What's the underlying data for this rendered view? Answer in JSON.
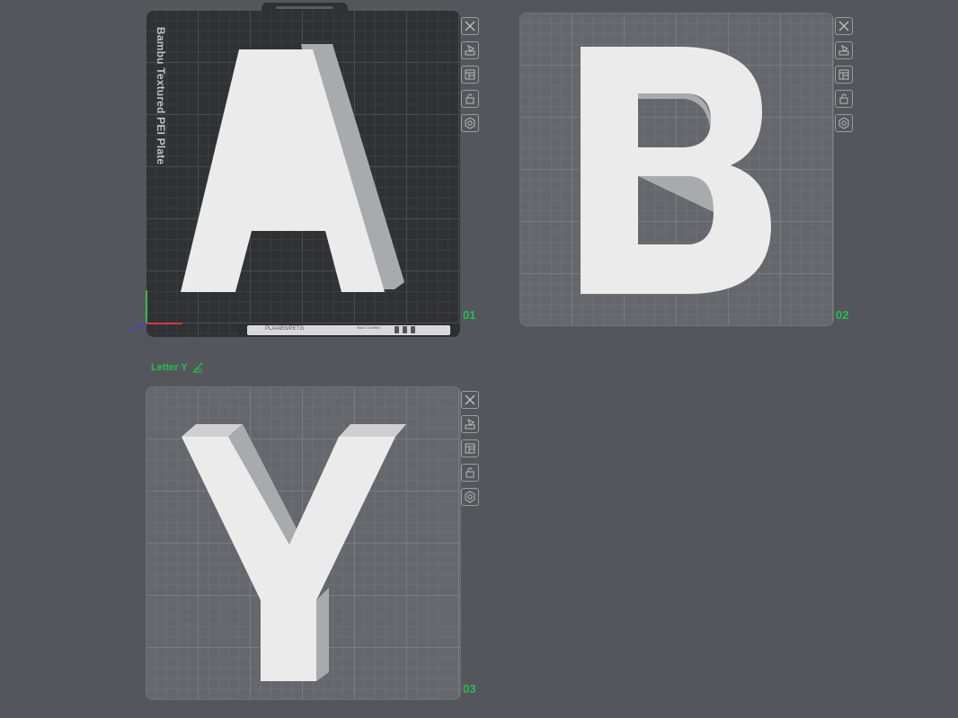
{
  "plates": [
    {
      "number": "01",
      "letter": "A",
      "bed_label": "Bambu Textured PEI Plate",
      "footer_text": "PLA/ABS/PETG",
      "footer_note": "SMO COMPAT."
    },
    {
      "number": "02",
      "letter": "B"
    },
    {
      "number": "03",
      "letter": "Y"
    }
  ],
  "object_label": "Letter Y",
  "toolbar_icons": [
    "close-icon",
    "auto-orient-icon",
    "arrange-icon",
    "lock-icon",
    "settings-icon"
  ],
  "colors": {
    "background": "#55565c",
    "plate_number": "#1fc24a",
    "letter_face": "#ebebec",
    "letter_side": "#a9aaae"
  }
}
